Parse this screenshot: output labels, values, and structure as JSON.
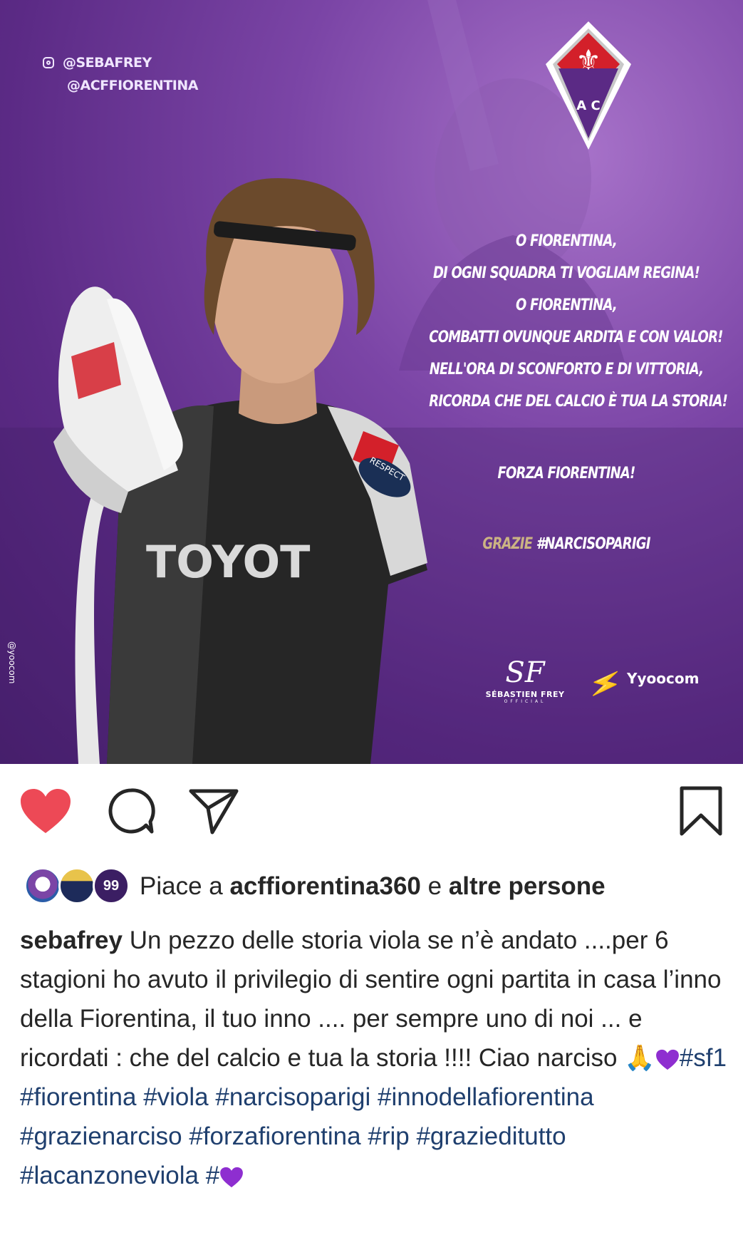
{
  "post": {
    "handles": [
      "@SEBAFREY",
      "@ACFFIORENTINA"
    ],
    "crest_letters": "A  C",
    "anthem_lines": [
      "O FIORENTINA,",
      "DI OGNI SQUADRA TI VOGLIAM REGINA!",
      "O FIORENTINA,",
      "COMBATTI OVUNQUE ARDITA E CON VALOR!",
      "NELL'ORA DI SCONFORTO E DI VITTORIA,",
      "RICORDA CHE DEL CALCIO È TUA LA STORIA!"
    ],
    "forza": "FORZA FIORENTINA!",
    "grazie_word": "GRAZIE",
    "grazie_tag": "#NARCISOPARIGI",
    "jersey_sponsor": "TOYOT",
    "sleeve_badge": "RESPECT",
    "logo_monogram": "SF",
    "logo_name": "SÉBASTIEN FREY",
    "logo_sub": "OFFICIAL",
    "yoocom": "yoocom",
    "side_credit": "@yoocom"
  },
  "actions": {
    "like_icon": "heart-icon-filled",
    "comment_icon": "comment-icon",
    "share_icon": "send-icon",
    "save_icon": "bookmark-icon",
    "like_color": "#ed4956"
  },
  "likes": {
    "prefix": "Piace a ",
    "account": "acffiorentina360",
    "middle": " e ",
    "others": "altre persone",
    "avatar3_label": "99"
  },
  "caption": {
    "username": "sebafrey",
    "text": " Un pezzo delle storia viola se n’è andato ....per 6 stagioni ho avuto il privilegio di sentire ogni partita in casa l’inno della Fiorentina, il tuo inno .... per sempre uno di noi ... e ricordati : che del calcio e tua la storia !!!! Ciao narciso ",
    "emoji_pray": "🙏",
    "hashtags": [
      "#sf1",
      "#fiorentina",
      "#viola",
      "#narcisoparigi",
      "#innodellafiorentina",
      "#grazienarciso",
      "#forzafiorentina",
      "#rip",
      "#grazieditutto",
      "#lacanzoneviola",
      "#"
    ]
  },
  "colors": {
    "purple": "#5b2a85",
    "hashtag": "#1f3f6e",
    "gold": "#cbb383"
  }
}
